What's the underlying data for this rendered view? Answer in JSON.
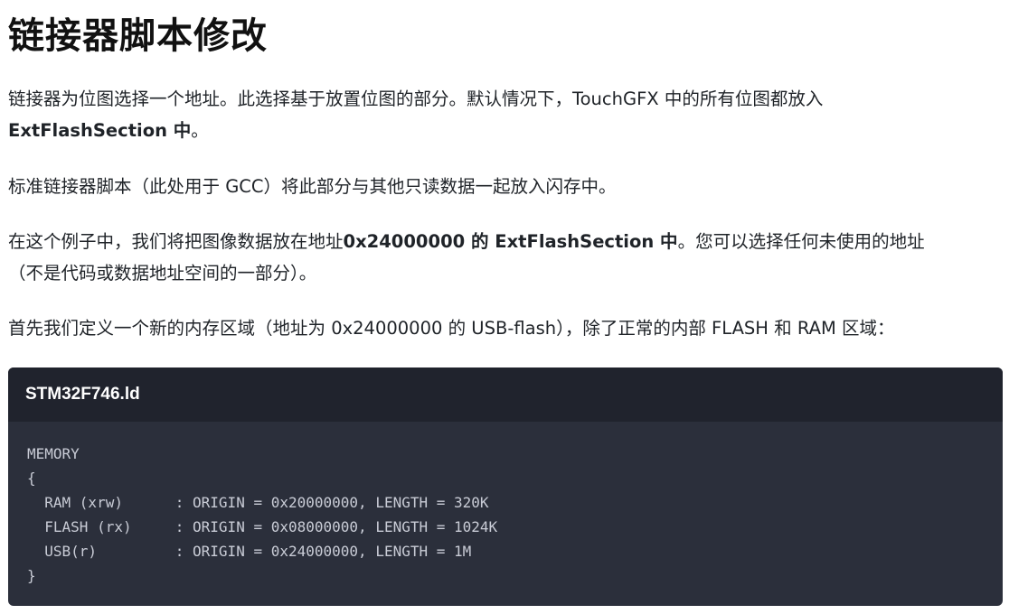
{
  "page": {
    "title": "链接器脚本修改"
  },
  "paragraphs": {
    "p1_line1": "链接器为位图选择一个地址。此选择基于放置位图的部分。默认情况下，TouchGFX 中的所有位图都放入",
    "p1_bold": "ExtFlashSection 中",
    "p1_end": "。",
    "p2": "标准链接器脚本（此处用于 GCC）将此部分与其他只读数据一起放入闪存中。",
    "p3_start": "在这个例子中，我们将把图像数据放在地址",
    "p3_bold": "0x24000000 的 ExtFlashSection 中",
    "p3_rest": "。您可以选择任何未使用的地址",
    "p3_line2": "（不是代码或数据地址空间的一部分）。",
    "p4": "首先我们定义一个新的内存区域（地址为 0x24000000 的 USB-flash），除了正常的内部 FLASH 和 RAM 区域："
  },
  "code_block": {
    "filename": "STM32F746.ld",
    "lines": [
      "MEMORY",
      "{",
      "  RAM (xrw)      : ORIGIN = 0x20000000, LENGTH = 320K",
      "  FLASH (rx)     : ORIGIN = 0x08000000, LENGTH = 1024K",
      "  USB(r)         : ORIGIN = 0x24000000, LENGTH = 1M",
      "}"
    ]
  }
}
